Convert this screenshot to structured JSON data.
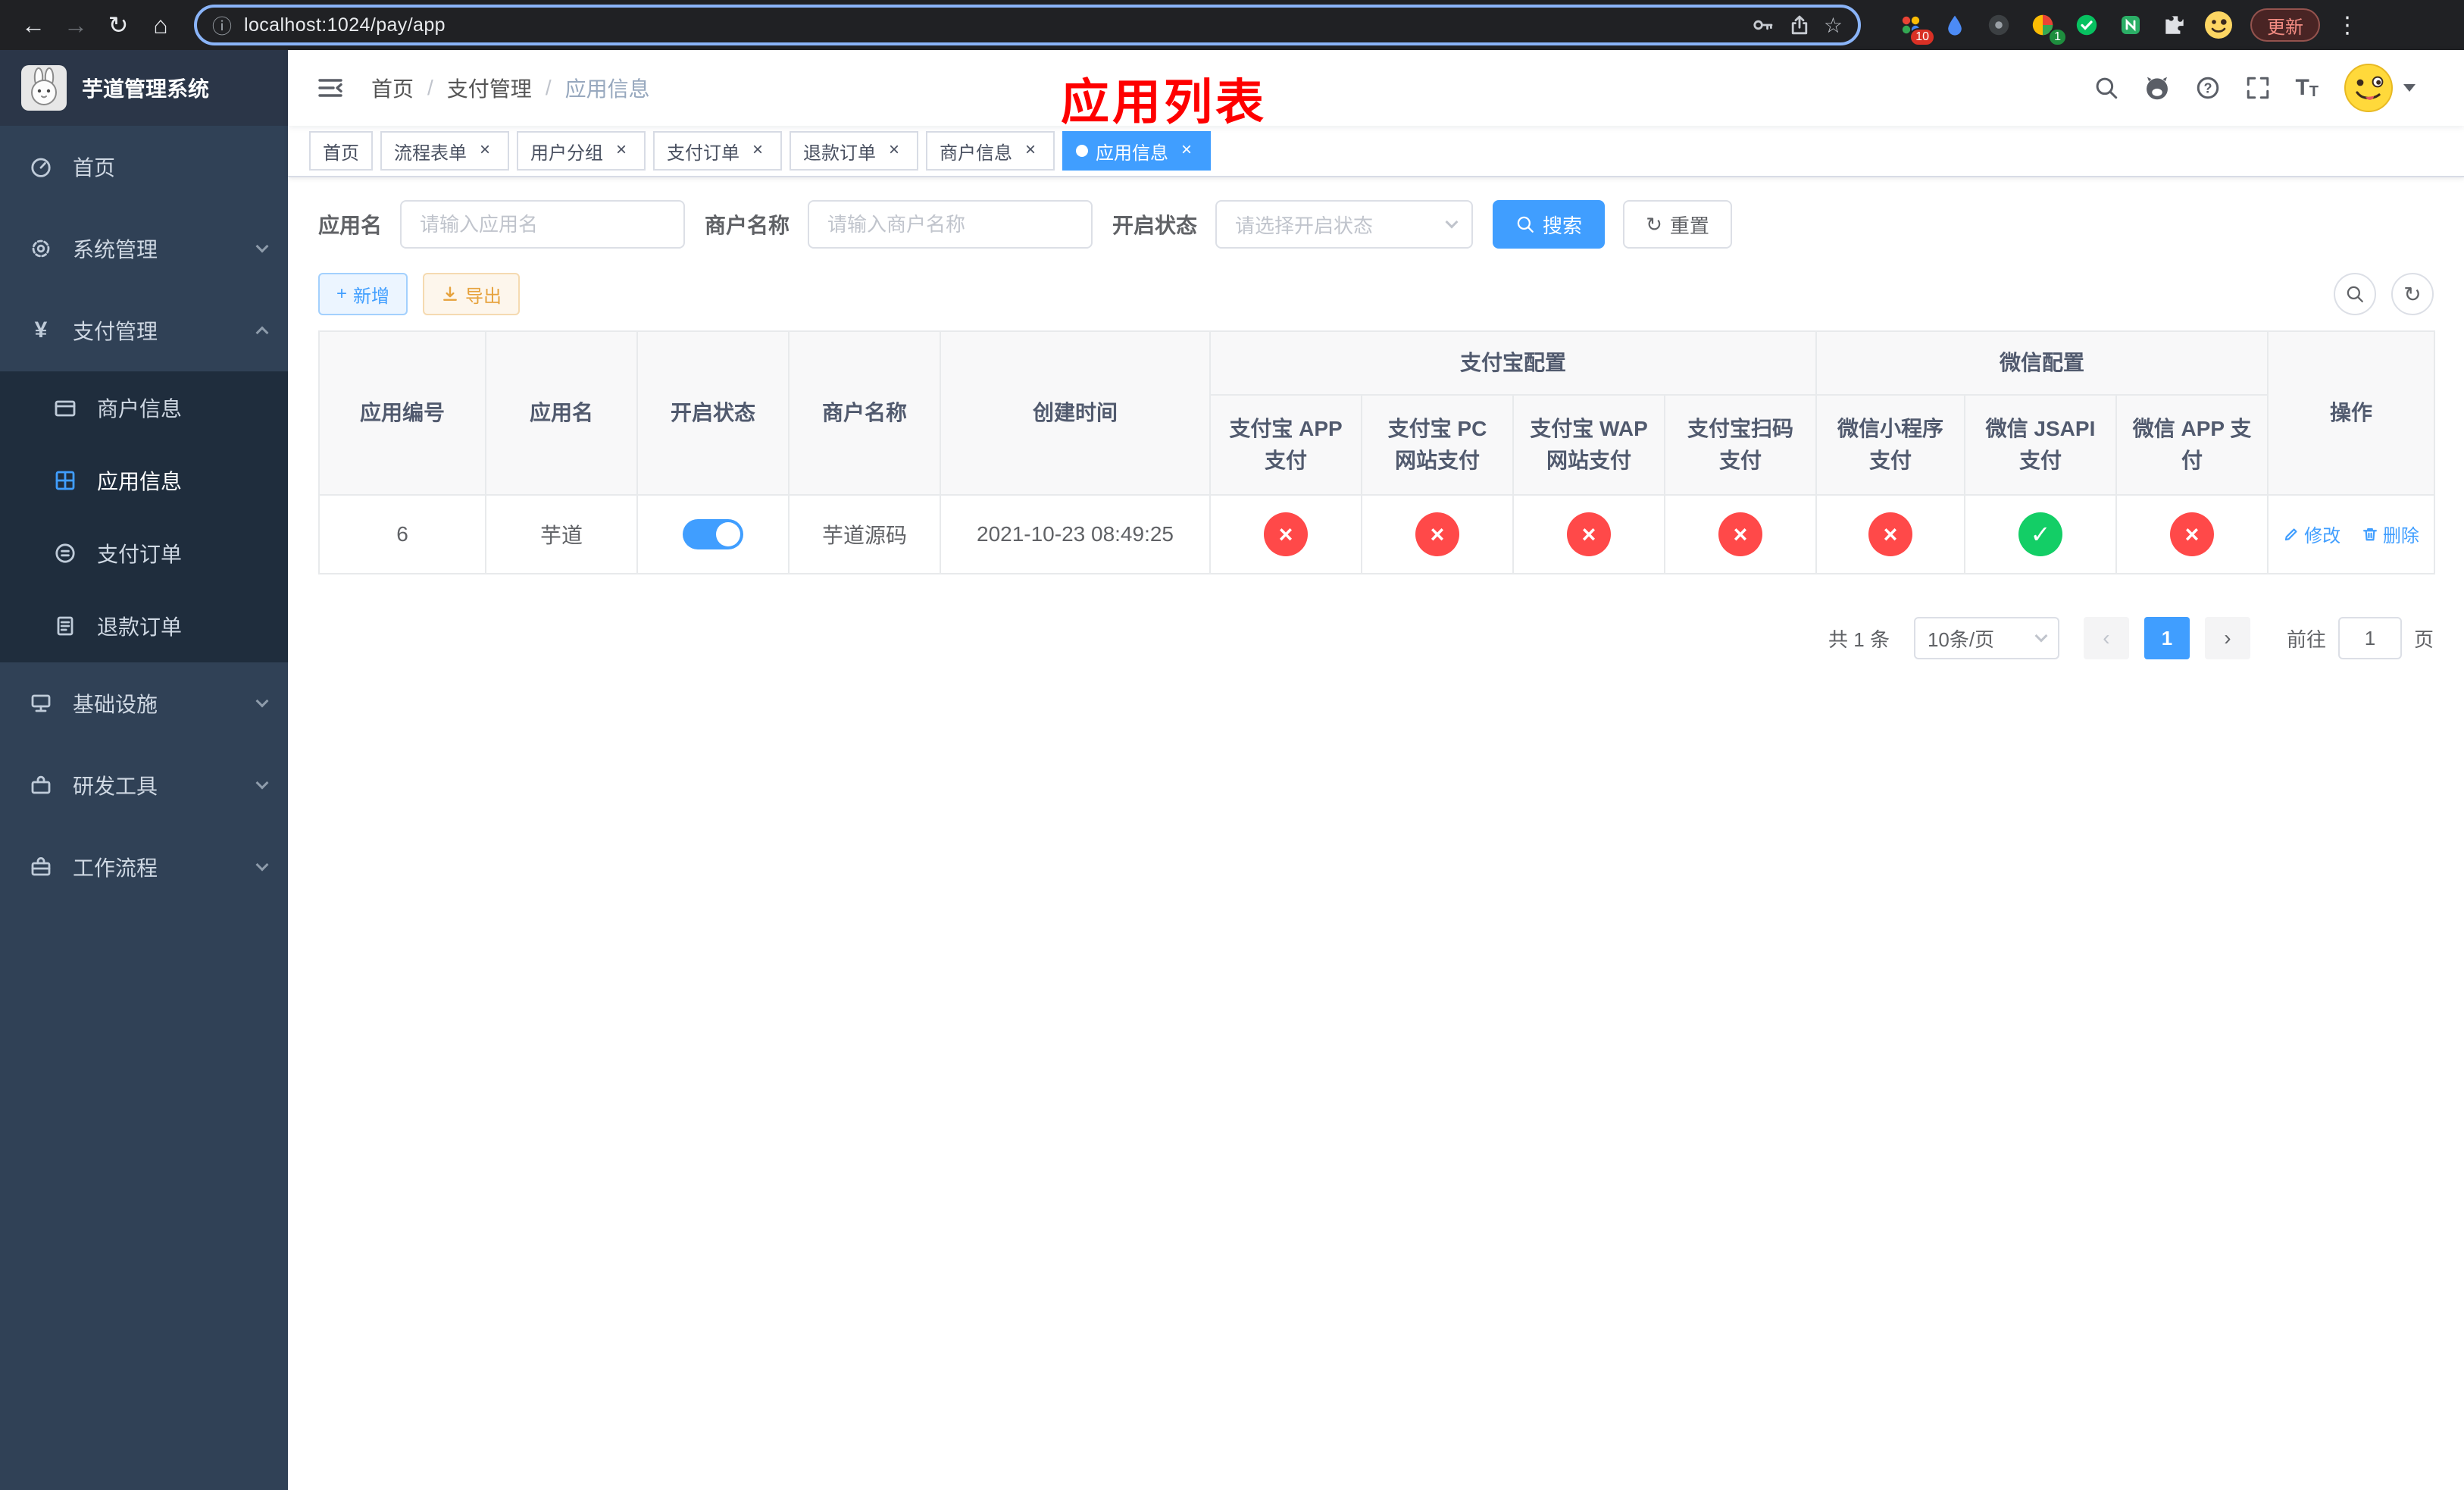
{
  "colors": {
    "primary": "#409eff",
    "success": "#13ce66",
    "danger": "#ff4949",
    "warning": "#e6a23c",
    "sidebar_bg": "#304156",
    "submenu_bg": "#1f2d3d",
    "annotation_red": "#fe0000"
  },
  "glyphs": {
    "back": "←",
    "forward": "→",
    "reload": "↻",
    "home": "⌂",
    "info": "ⓘ",
    "star": "☆",
    "menu_dots": "⋮",
    "close": "×",
    "plus": "+",
    "refresh": "↻",
    "breadcrumb_sep": "/",
    "prev": "‹",
    "next": "›",
    "yen": "¥",
    "font_size": "T"
  },
  "browser": {
    "url": "localhost:1024/pay/app",
    "update_label": "更新",
    "ext_badge_puzzle": "10",
    "ext_badge_profile": "1"
  },
  "sidebar": {
    "logo_title": "芋道管理系统",
    "items": [
      {
        "label": "首页"
      },
      {
        "label": "系统管理"
      },
      {
        "label": "支付管理"
      },
      {
        "label": "基础设施"
      },
      {
        "label": "研发工具"
      },
      {
        "label": "工作流程"
      }
    ],
    "payment_children": [
      {
        "label": "商户信息"
      },
      {
        "label": "应用信息"
      },
      {
        "label": "支付订单"
      },
      {
        "label": "退款订单"
      }
    ]
  },
  "header": {
    "breadcrumb": [
      "首页",
      "支付管理",
      "应用信息"
    ],
    "title_annotation": "应用列表"
  },
  "tabs": [
    {
      "label": "首页"
    },
    {
      "label": "流程表单"
    },
    {
      "label": "用户分组"
    },
    {
      "label": "支付订单"
    },
    {
      "label": "退款订单"
    },
    {
      "label": "商户信息"
    },
    {
      "label": "应用信息"
    }
  ],
  "filters": {
    "app_name_label": "应用名",
    "app_name_placeholder": "请输入应用名",
    "merchant_label": "商户名称",
    "merchant_placeholder": "请输入商户名称",
    "status_label": "开启状态",
    "status_placeholder": "请选择开启状态",
    "search_label": "搜索",
    "reset_label": "重置"
  },
  "toolbar": {
    "add_label": "新增",
    "export_label": "导出"
  },
  "table": {
    "columns": {
      "app_id": "应用编号",
      "app_name": "应用名",
      "status": "开启状态",
      "merchant": "商户名称",
      "create_time": "创建时间",
      "alipay_group": "支付宝配置",
      "ali_app": "支付宝 APP 支付",
      "ali_pc": "支付宝 PC 网站支付",
      "ali_wap": "支付宝 WAP 网站支付",
      "ali_qr": "支付宝扫码支付",
      "wechat_group": "微信配置",
      "wx_lite": "微信小程序支付",
      "wx_jsapi": "微信 JSAPI 支付",
      "wx_app": "微信 APP 支付",
      "ops": "操作"
    },
    "row": {
      "app_id": "6",
      "app_name": "芋道",
      "status_on": "true",
      "merchant": "芋道源码",
      "create_time": "2021-10-23 08:49:25",
      "configs": {
        "ali_app": {
          "glyph": "×",
          "state": "off"
        },
        "ali_pc": {
          "glyph": "×",
          "state": "off"
        },
        "ali_wap": {
          "glyph": "×",
          "state": "off"
        },
        "ali_qr": {
          "glyph": "×",
          "state": "off"
        },
        "wx_lite": {
          "glyph": "×",
          "state": "off"
        },
        "wx_jsapi": {
          "glyph": "✓",
          "state": "on"
        },
        "wx_app": {
          "glyph": "×",
          "state": "off"
        }
      },
      "edit_label": "修改",
      "delete_label": "删除"
    }
  },
  "pagination": {
    "total": "共 1 条",
    "page_size": "10条/页",
    "page": "1",
    "goto_label": "前往",
    "goto_value": "1",
    "unit_label": "页"
  }
}
